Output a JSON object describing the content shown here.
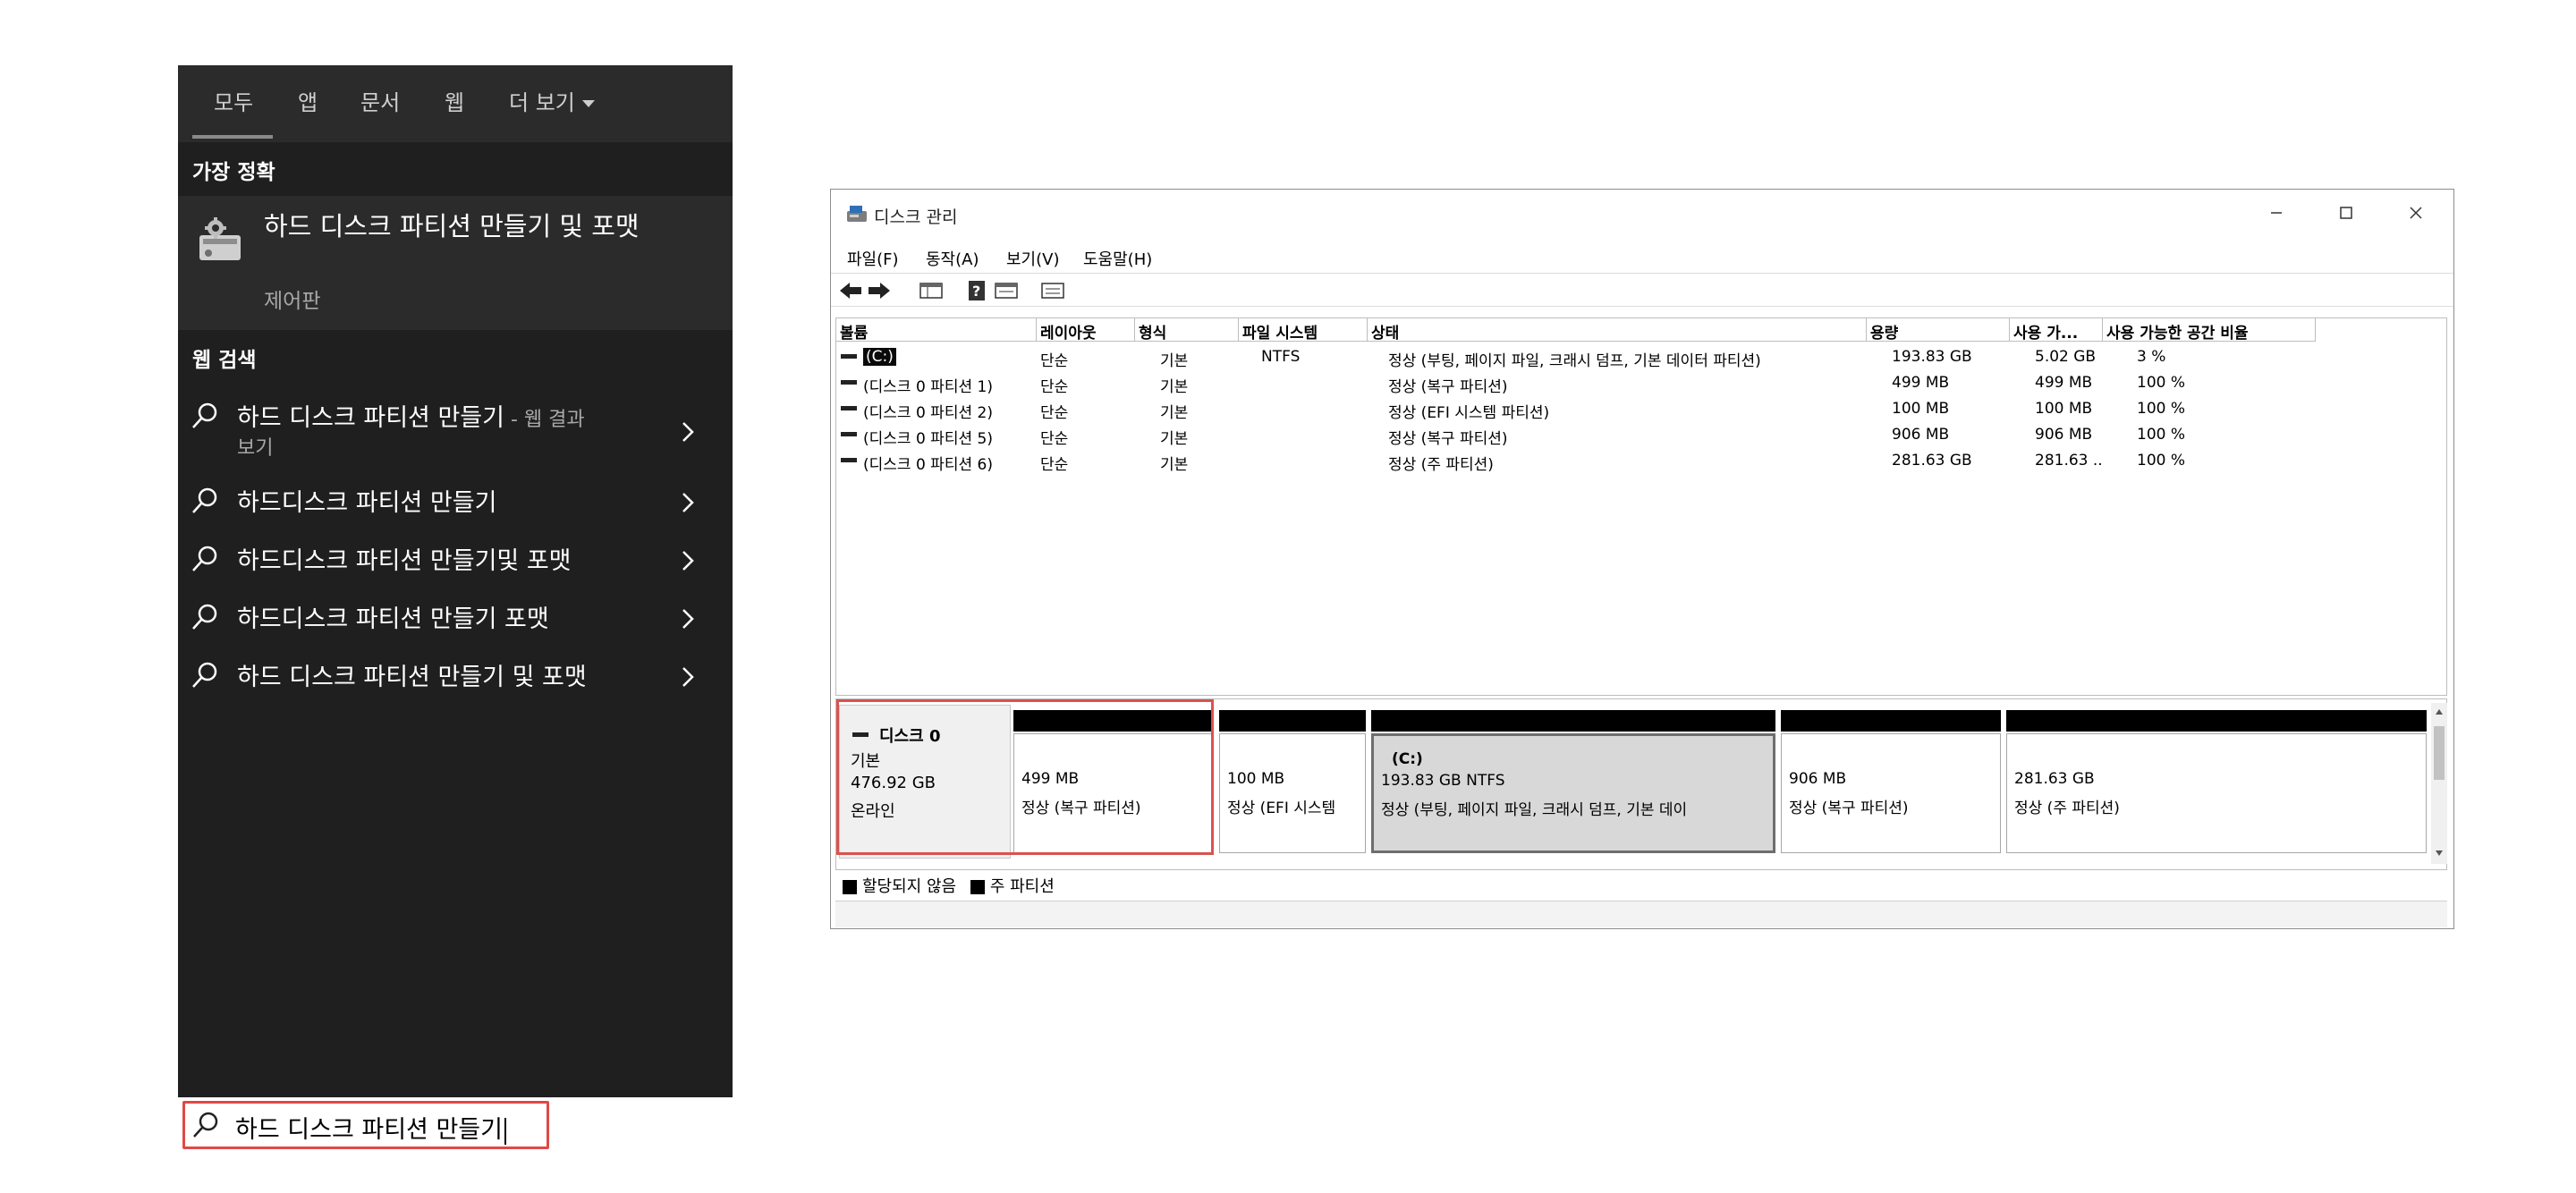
{
  "search": {
    "tabs": [
      "모두",
      "앱",
      "문서",
      "웹",
      "더 보기"
    ],
    "best_match_header": "가장 정확",
    "best_match": {
      "title": "하드 디스크 파티션 만들기 및 포맷",
      "subtitle": "제어판"
    },
    "web_header": "웹 검색",
    "web_results": [
      {
        "text": "하드 디스크 파티션 만들기",
        "suffix": " - 웹 결과",
        "line2": "보기"
      },
      {
        "text": "하드디스크 파티션 만들기",
        "suffix": "",
        "line2": ""
      },
      {
        "text": "하드디스크 파티션 만들기및 포맷",
        "suffix": "",
        "line2": ""
      },
      {
        "text": "하드디스크 파티션 만들기 포맷",
        "suffix": "",
        "line2": ""
      },
      {
        "text": "하드 디스크 파티션 만들기 및 포맷",
        "suffix": "",
        "line2": ""
      }
    ],
    "query": "하드 디스크 파티션 만들기"
  },
  "disk_mgmt": {
    "title": "디스크 관리",
    "menu": [
      "파일(F)",
      "동작(A)",
      "보기(V)",
      "도움말(H)"
    ],
    "columns": [
      "볼륨",
      "레이아웃",
      "형식",
      "파일 시스템",
      "상태",
      "용량",
      "사용 가...",
      "사용 가능한 공간 비율"
    ],
    "volumes": [
      {
        "volume": "(C:)",
        "layout": "단순",
        "type": "기본",
        "fs": "NTFS",
        "status": "정상 (부팅, 페이지 파일, 크래시 덤프, 기본 데이터 파티션)",
        "capacity": "193.83 GB",
        "free": "5.02 GB",
        "pct": "3 %"
      },
      {
        "volume": "(디스크 0 파티션 1)",
        "layout": "단순",
        "type": "기본",
        "fs": "",
        "status": "정상 (복구 파티션)",
        "capacity": "499 MB",
        "free": "499 MB",
        "pct": "100 %"
      },
      {
        "volume": "(디스크 0 파티션 2)",
        "layout": "단순",
        "type": "기본",
        "fs": "",
        "status": "정상 (EFI 시스템 파티션)",
        "capacity": "100 MB",
        "free": "100 MB",
        "pct": "100 %"
      },
      {
        "volume": "(디스크 0 파티션 5)",
        "layout": "단순",
        "type": "기본",
        "fs": "",
        "status": "정상 (복구 파티션)",
        "capacity": "906 MB",
        "free": "906 MB",
        "pct": "100 %"
      },
      {
        "volume": "(디스크 0 파티션 6)",
        "layout": "단순",
        "type": "기본",
        "fs": "",
        "status": "정상 (주 파티션)",
        "capacity": "281.63 GB",
        "free": "281.63 ...",
        "pct": "100 %"
      }
    ],
    "disk": {
      "name": "디스크 0",
      "type": "기본",
      "size": "476.92 GB",
      "state": "온라인"
    },
    "partitions": [
      {
        "name": "",
        "size": "499 MB",
        "status": "정상 (복구 파티션)"
      },
      {
        "name": "",
        "size": "100 MB",
        "status": "정상 (EFI 시스템"
      },
      {
        "name": "(C:)",
        "size": "193.83 GB NTFS",
        "status": "정상 (부팅, 페이지 파일, 크래시 덤프, 기본 데이"
      },
      {
        "name": "",
        "size": "906 MB",
        "status": "정상 (복구 파티션)"
      },
      {
        "name": "",
        "size": "281.63 GB",
        "status": "정상 (주 파티션)"
      }
    ],
    "legend": [
      "할당되지 않음",
      "주 파티션"
    ]
  }
}
